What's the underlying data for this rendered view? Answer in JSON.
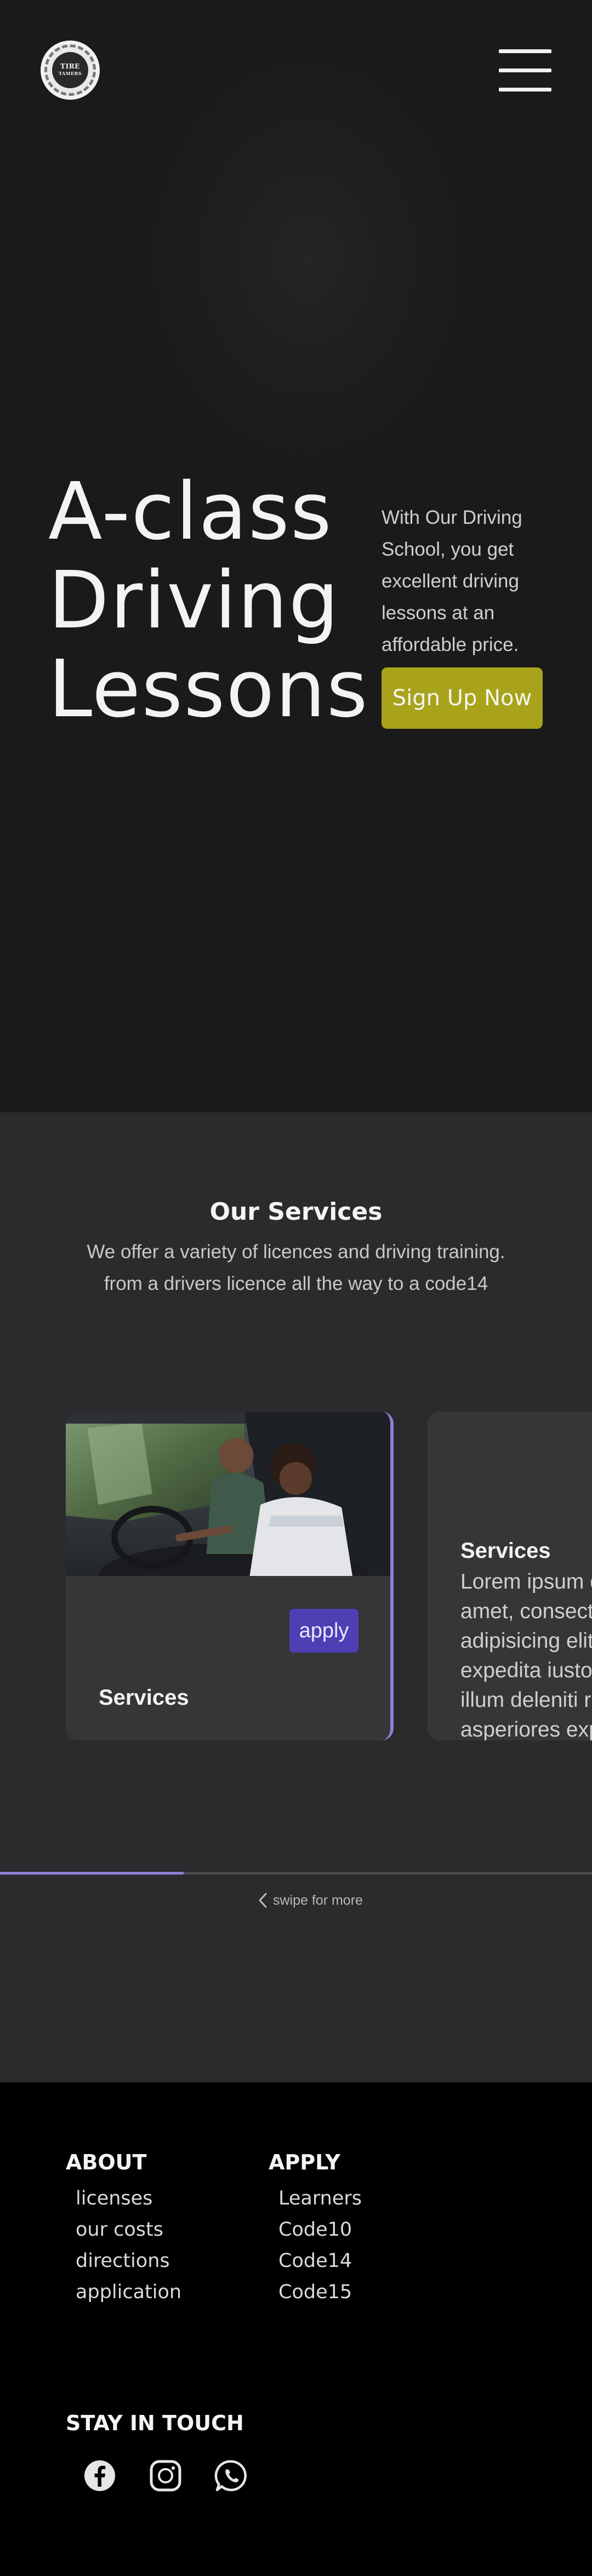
{
  "header": {
    "logo_text_line1": "TIRE",
    "logo_text_line2": "TAMERS",
    "menu_icon": "hamburger-menu-icon"
  },
  "hero": {
    "title_line1": "A-class",
    "title_line2": "Driving",
    "title_line3": "Lessons",
    "text_lines": [
      "With Our Driving",
      "School, you get",
      "excellent driving",
      "lessons at an",
      "affordable price."
    ],
    "cta_label": "Sign Up Now",
    "cta_color": "#a8a31b"
  },
  "services": {
    "title": "Our Services",
    "subtitle_line1": "We offer a variety of licences and driving training.",
    "subtitle_line2": "from a drivers licence all the way to a code14",
    "cards": [
      {
        "image": "driving-lesson-photo",
        "button_label": "apply",
        "label": "Services"
      },
      {
        "title": "Services",
        "body": "Lorem ipsum dolor sit\namet, consectetur\nadipisicing elit. Quos\nexpedita iusto quam\nillum deleniti repellat\nasperiores expedita"
      }
    ],
    "scroll_progress": 0.31,
    "swipe_hint": "swipe for more",
    "accent_color": "#8d7fd6",
    "button_color": "#4e3fb4"
  },
  "footer": {
    "about": {
      "heading": "ABOUT",
      "links": [
        "licenses",
        "our costs",
        "directions",
        "application"
      ]
    },
    "apply": {
      "heading": "APPLY",
      "links": [
        "Learners",
        "Code10",
        "Code14",
        "Code15"
      ]
    },
    "stay_in_touch": "STAY IN TOUCH",
    "socials": [
      "facebook-icon",
      "instagram-icon",
      "whatsapp-icon"
    ]
  }
}
